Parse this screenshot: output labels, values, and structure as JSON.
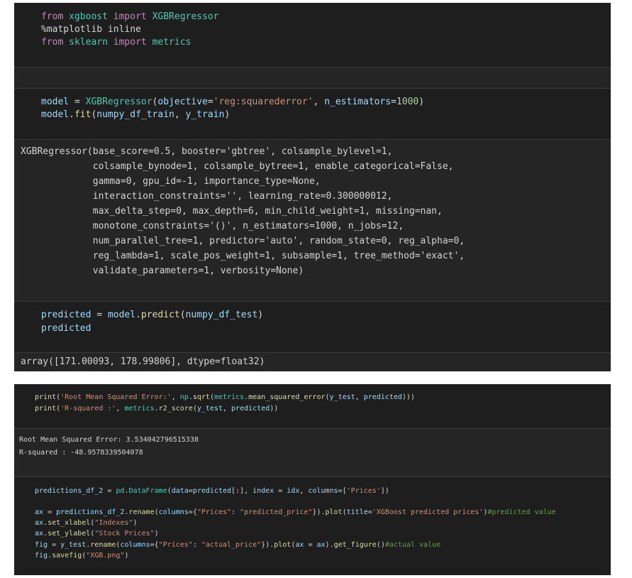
{
  "cell1": {
    "line1": {
      "kw1": "from",
      "mod": "xgboost",
      "kw2": "import",
      "cls": "XGBRegressor"
    },
    "line2": {
      "magic": "%matplotlib inline"
    },
    "line3": {
      "kw1": "from",
      "mod": "sklearn",
      "kw2": "import",
      "name": "metrics"
    }
  },
  "cell2": {
    "line1": {
      "var": "model",
      "eq": " = ",
      "cls": "XGBRegressor",
      "p1": "(",
      "arg1": "objective",
      "eq1": "=",
      "str1": "'reg:squarederror'",
      "comma": ", ",
      "arg2": "n_estimators",
      "eq2": "=",
      "num": "1000",
      "p2": ")"
    },
    "line2": {
      "var": "model",
      "dot": ".",
      "fn": "fit",
      "p1": "(",
      "a1": "numpy_df_train",
      "comma": ", ",
      "a2": "y_train",
      "p2": ")"
    }
  },
  "output2": {
    "lines": [
      "XGBRegressor(base_score=0.5, booster='gbtree', colsample_bylevel=1,",
      "             colsample_bynode=1, colsample_bytree=1, enable_categorical=False,",
      "             gamma=0, gpu_id=-1, importance_type=None,",
      "             interaction_constraints='', learning_rate=0.300000012,",
      "             max_delta_step=0, max_depth=6, min_child_weight=1, missing=nan,",
      "             monotone_constraints='()', n_estimators=1000, n_jobs=12,",
      "             num_parallel_tree=1, predictor='auto', random_state=0, reg_alpha=0,",
      "             reg_lambda=1, scale_pos_weight=1, subsample=1, tree_method='exact',",
      "             validate_parameters=1, verbosity=None)"
    ]
  },
  "cell3": {
    "line1": {
      "var": "predicted",
      "eq": " = ",
      "obj": "model",
      "dot": ".",
      "fn": "predict",
      "p1": "(",
      "arg": "numpy_df_test",
      "p2": ")"
    },
    "line2": {
      "var": "predicted"
    }
  },
  "output3": {
    "text": "array([171.00093, 178.99806], dtype=float32)"
  },
  "cell4": {
    "line1": {
      "fn": "print",
      "p1": "(",
      "str": "'Root Mean Squared Error:'",
      "c1": ", ",
      "np": "np",
      "d1": ".",
      "sqrt": "sqrt",
      "p2": "(",
      "metrics": "metrics",
      "d2": ".",
      "mse": "mean_squared_error",
      "p3": "(",
      "yt": "y_test",
      "c2": ", ",
      "pred": "predicted",
      "p4": ")))"
    },
    "line2": {
      "fn": "print",
      "p1": "(",
      "str": "'R-squared :'",
      "c1": ", ",
      "metrics": "metrics",
      "d1": ".",
      "r2": "r2_score",
      "p2": "(",
      "yt": "y_test",
      "c2": ", ",
      "pred": "predicted",
      "p3": "))"
    }
  },
  "output4": {
    "line1": "Root Mean Squared Error: 3.534042796515338",
    "line2": "R-squared : -48.9578339504078"
  },
  "cell5": {
    "line1": {
      "var": "predictions_df_2",
      "eq": " = ",
      "pd": "pd",
      "d1": ".",
      "cls": "DataFrame",
      "p1": "(",
      "a1": "data",
      "e1": "=",
      "pred": "predicted",
      "slice": "[:]",
      "c1": ", ",
      "a2": "index",
      "e2": " = ",
      "idx": "idx",
      "c2": ", ",
      "a3": "columns",
      "e3": "=",
      "lst1": "[",
      "s1": "'Prices'",
      "lst2": "])"
    },
    "line2": {
      "ax": "ax",
      "eq": " = ",
      "df": "predictions_df_2",
      "d1": ".",
      "rename": "rename",
      "p1": "(",
      "a1": "columns",
      "e1": "=",
      "b1": "{",
      "s1": "\"Prices\"",
      "col": ": ",
      "s2": "\"predicted_price\"",
      "b2": "})",
      "d2": ".",
      "plot": "plot",
      "p2": "(",
      "a2": "title",
      "e2": "=",
      "s3": "'XGBoost predicted prices'",
      "p3": ")",
      "cmt": "#predicted value"
    },
    "line3": {
      "ax": "ax",
      "d1": ".",
      "fn": "set_xlabel",
      "p1": "(",
      "s1": "\"Indexes\"",
      "p2": ")"
    },
    "line4": {
      "ax": "ax",
      "d1": ".",
      "fn": "set_ylabel",
      "p1": "(",
      "s1": "\"Stock Prices\"",
      "p2": ")"
    },
    "line5": {
      "fig": "fig",
      "eq": " = ",
      "yt": "y_test",
      "d1": ".",
      "rename": "rename",
      "p1": "(",
      "a1": "columns",
      "e1": "=",
      "b1": "{",
      "s1": "\"Prices\"",
      "col": ": ",
      "s2": "\"actual_price\"",
      "b2": "})",
      "d2": ".",
      "plot": "plot",
      "p2": "(",
      "a2": "ax",
      "e2": " = ",
      "axv": "ax",
      "p3": ")",
      "d3": ".",
      "gf": "get_figure",
      "p4": "()",
      "cmt": "#actual value"
    },
    "line6": {
      "fig": "fig",
      "d1": ".",
      "fn": "savefig",
      "p1": "(",
      "s1": "\"XGB.png\"",
      "p2": ")"
    }
  }
}
